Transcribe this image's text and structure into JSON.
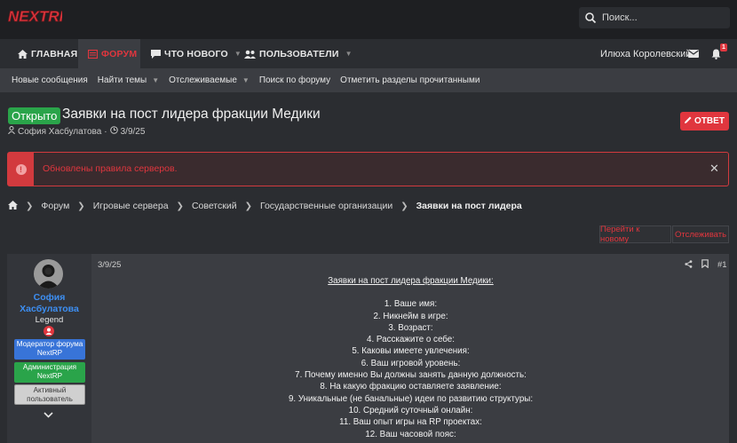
{
  "header": {
    "logo_text": "NEXTRP",
    "search_placeholder": "Поиск..."
  },
  "nav": {
    "items": [
      {
        "label": "ГЛАВНАЯ"
      },
      {
        "label": "ФОРУМ"
      },
      {
        "label": "ЧТО НОВОГО"
      },
      {
        "label": "ПОЛЬЗОВАТЕЛИ"
      }
    ],
    "user": "Илюха Королевский",
    "notif_count": "1"
  },
  "subnav": {
    "items": [
      "Новые сообщения",
      "Найти темы",
      "Отслеживаемые",
      "Поиск по форуму",
      "Отметить разделы прочитанными"
    ]
  },
  "thread": {
    "status": "Открыто",
    "title": "Заявки на пост лидера фракции Медики",
    "author": "София Хасбулатова",
    "date": "3/9/25",
    "reply_label": "ОТВЕТ"
  },
  "alert": {
    "message": "Обновлены правила серверов.",
    "close": "✕"
  },
  "breadcrumb": [
    "Форум",
    "Игровые сервера",
    "Советский",
    "Государственные организации",
    "Заявки на пост лидера"
  ],
  "actions": {
    "goto_new": "Перейти к новому",
    "watch": "Отслеживать"
  },
  "post": {
    "user": {
      "name_line1": "София",
      "name_line2": "Хасбулатова",
      "title": "Legend",
      "banners": [
        {
          "line1": "Модератор форума",
          "line2": "NextRP"
        },
        {
          "line1": "Администрация",
          "line2": "NextRP"
        },
        {
          "line1": "Активный",
          "line2": "пользователь"
        }
      ]
    },
    "date": "3/9/25",
    "number": "#1",
    "content_title": "Заявки на пост лидера фракции Медики:",
    "lines": [
      "1. Ваше имя:",
      "2. Никнейм в игре:",
      "3. Возраст:",
      "4. Расскажите о себе:",
      "5. Каковы имеете увлечения:",
      "6. Ваш игровой уровень:",
      "7. Почему именно Вы должны занять данную должность:",
      "8. На какую фракцию оставляете заявление:",
      "9. Уникальные (не банальные) идеи по развитию структуры:",
      "10. Средний суточный онлайн:",
      "11. Ваш опыт игры на RP проектах:",
      "12. Ваш часовой пояс:"
    ]
  },
  "colors": {
    "accent": "#e0363e",
    "open_badge": "#2aa44a",
    "username": "#3d8ff3"
  }
}
